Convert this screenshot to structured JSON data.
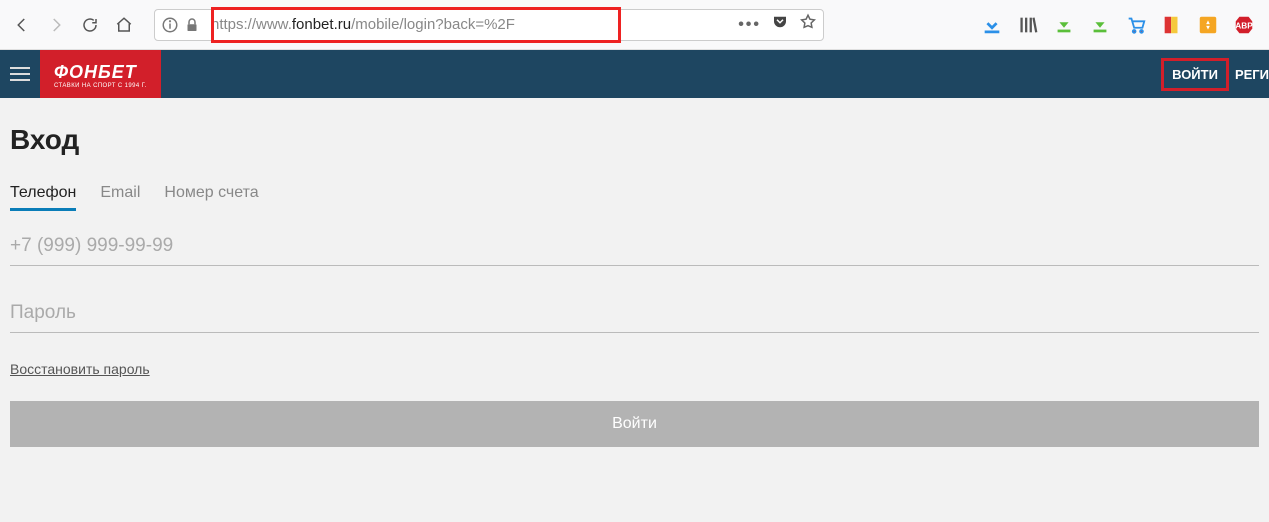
{
  "browser": {
    "url_prefix": "https://www.",
    "url_domain": "fonbet.ru",
    "url_path": "/mobile/login?back=%2F"
  },
  "site_header": {
    "logo_main": "ФОНБЕТ",
    "logo_sub": "СТАВКИ НА СПОРТ С 1994 Г.",
    "login": "ВОЙТИ",
    "register": "РЕГИ"
  },
  "page": {
    "title": "Вход",
    "tabs": {
      "phone": "Телефон",
      "email": "Email",
      "account": "Номер счета"
    },
    "phone_placeholder": "+7 (999) 999-99-99",
    "password_placeholder": "Пароль",
    "recover": "Восстановить пароль",
    "submit": "Войти"
  }
}
